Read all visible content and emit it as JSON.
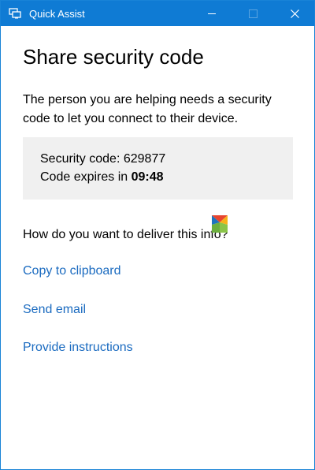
{
  "window": {
    "title": "Quick Assist",
    "accent_color": "#0f7bd4",
    "icons": {
      "app": "quick-assist-icon",
      "minimize": "minimize-icon",
      "maximize": "maximize-icon",
      "close": "close-icon"
    }
  },
  "page": {
    "heading": "Share security code",
    "description": "The person you are helping needs a security code to let you connect to their device.",
    "code_box": {
      "code_label": "Security code:",
      "code_value": "629877",
      "expires_label": "Code expires in",
      "expires_value": "09:48"
    },
    "question": "How do you want to deliver this info?",
    "links": {
      "copy": "Copy to clipboard",
      "email": "Send email",
      "instructions": "Provide instructions"
    },
    "link_color": "#1b6bc0",
    "overlay_logo": "colorful-logo-watermark"
  }
}
